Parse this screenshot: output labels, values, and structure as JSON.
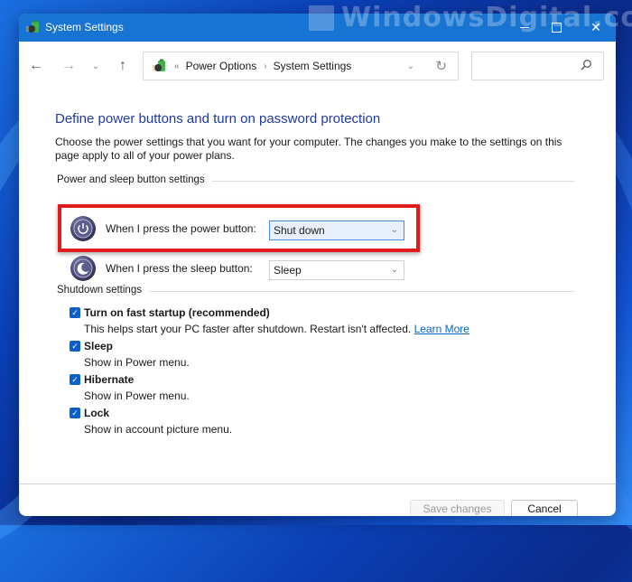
{
  "watermark": "WindowsDigital.com",
  "window": {
    "title": "System Settings",
    "controls": {
      "minimize": "minimize",
      "maximize": "maximize",
      "close": "close"
    }
  },
  "navbar": {
    "back_icon": "←",
    "forward_icon": "→",
    "recent_icon": "⌄",
    "up_icon": "↑",
    "address": {
      "overflow": "«",
      "breadcrumbs": [
        "Power Options",
        "System Settings"
      ],
      "separator": "›",
      "dropdown_icon": "⌄",
      "refresh_icon": "↻"
    },
    "search": {
      "placeholder": "",
      "value": ""
    }
  },
  "main": {
    "heading": "Define power buttons and turn on password protection",
    "intro": "Choose the power settings that you want for your computer. The changes you make to the settings on this page apply to all of your power plans.",
    "power_sleep_group": {
      "label": "Power and sleep button settings",
      "rows": [
        {
          "icon": "power-icon",
          "label": "When I press the power button:",
          "value": "Shut down"
        },
        {
          "icon": "sleep-icon",
          "label": "When I press the sleep button:",
          "value": "Sleep"
        }
      ]
    },
    "shutdown_group": {
      "label": "Shutdown settings",
      "items": [
        {
          "title": "Turn on fast startup (recommended)",
          "description": "This helps start your PC faster after shutdown. Restart isn't affected.",
          "link": "Learn More",
          "checked": true
        },
        {
          "title": "Sleep",
          "description": "Show in Power menu.",
          "checked": true
        },
        {
          "title": "Hibernate",
          "description": "Show in Power menu.",
          "checked": true
        },
        {
          "title": "Lock",
          "description": "Show in account picture menu.",
          "checked": true
        }
      ]
    }
  },
  "footer": {
    "save_label": "Save changes",
    "cancel_label": "Cancel"
  },
  "colors": {
    "titlebar": "#1874d2",
    "heading": "#1e3a9e",
    "highlight": "#e01c1c",
    "checkbox": "#0c5fc6",
    "link": "#0a64c8"
  }
}
